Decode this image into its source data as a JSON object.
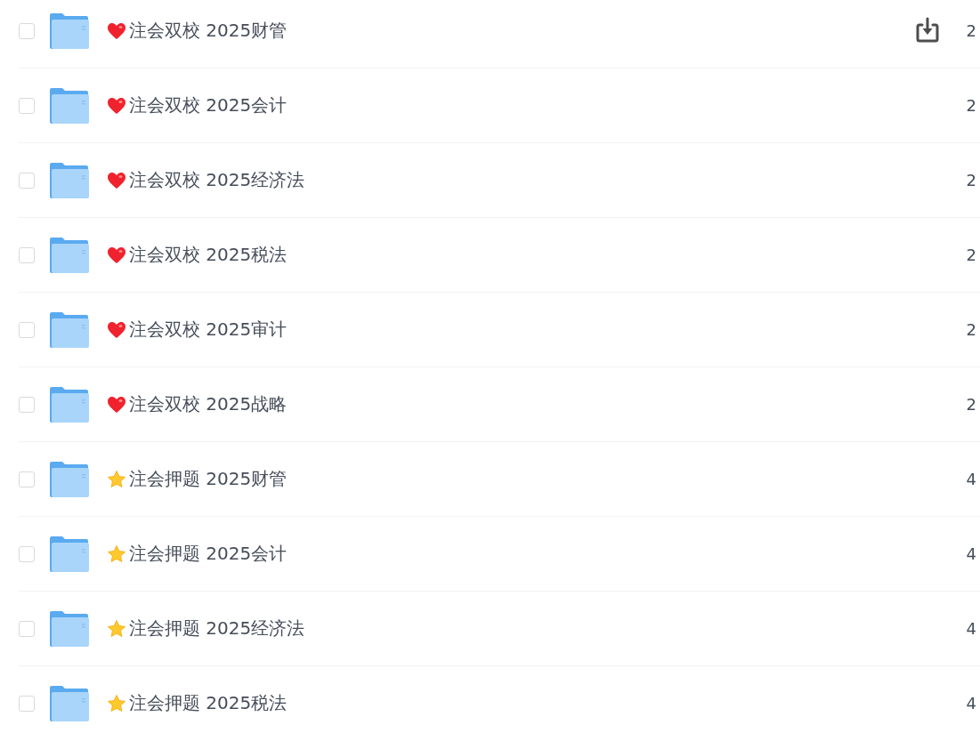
{
  "files": [
    {
      "name": "注会双校 2025财管",
      "kind": "heart",
      "checked": false,
      "download_shown": true,
      "column_3": "2"
    },
    {
      "name": "注会双校 2025会计",
      "kind": "heart",
      "checked": false,
      "download_shown": false,
      "column_3": "2"
    },
    {
      "name": "注会双校 2025经济法",
      "kind": "heart",
      "checked": false,
      "download_shown": false,
      "column_3": "2"
    },
    {
      "name": "注会双校 2025税法",
      "kind": "heart",
      "checked": false,
      "download_shown": false,
      "column_3": "2"
    },
    {
      "name": "注会双校 2025审计",
      "kind": "heart",
      "checked": false,
      "download_shown": false,
      "column_3": "2"
    },
    {
      "name": "注会双校 2025战略",
      "kind": "heart",
      "checked": false,
      "download_shown": false,
      "column_3": "2"
    },
    {
      "name": "注会押题 2025财管",
      "kind": "star",
      "checked": false,
      "download_shown": false,
      "column_3": "4"
    },
    {
      "name": "注会押题 2025会计",
      "kind": "star",
      "checked": false,
      "download_shown": false,
      "column_3": "4"
    },
    {
      "name": "注会押题 2025经济法",
      "kind": "star",
      "checked": false,
      "download_shown": false,
      "column_3": "4"
    },
    {
      "name": "注会押题 2025税法",
      "kind": "star",
      "checked": false,
      "download_shown": false,
      "column_3": "4"
    }
  ]
}
